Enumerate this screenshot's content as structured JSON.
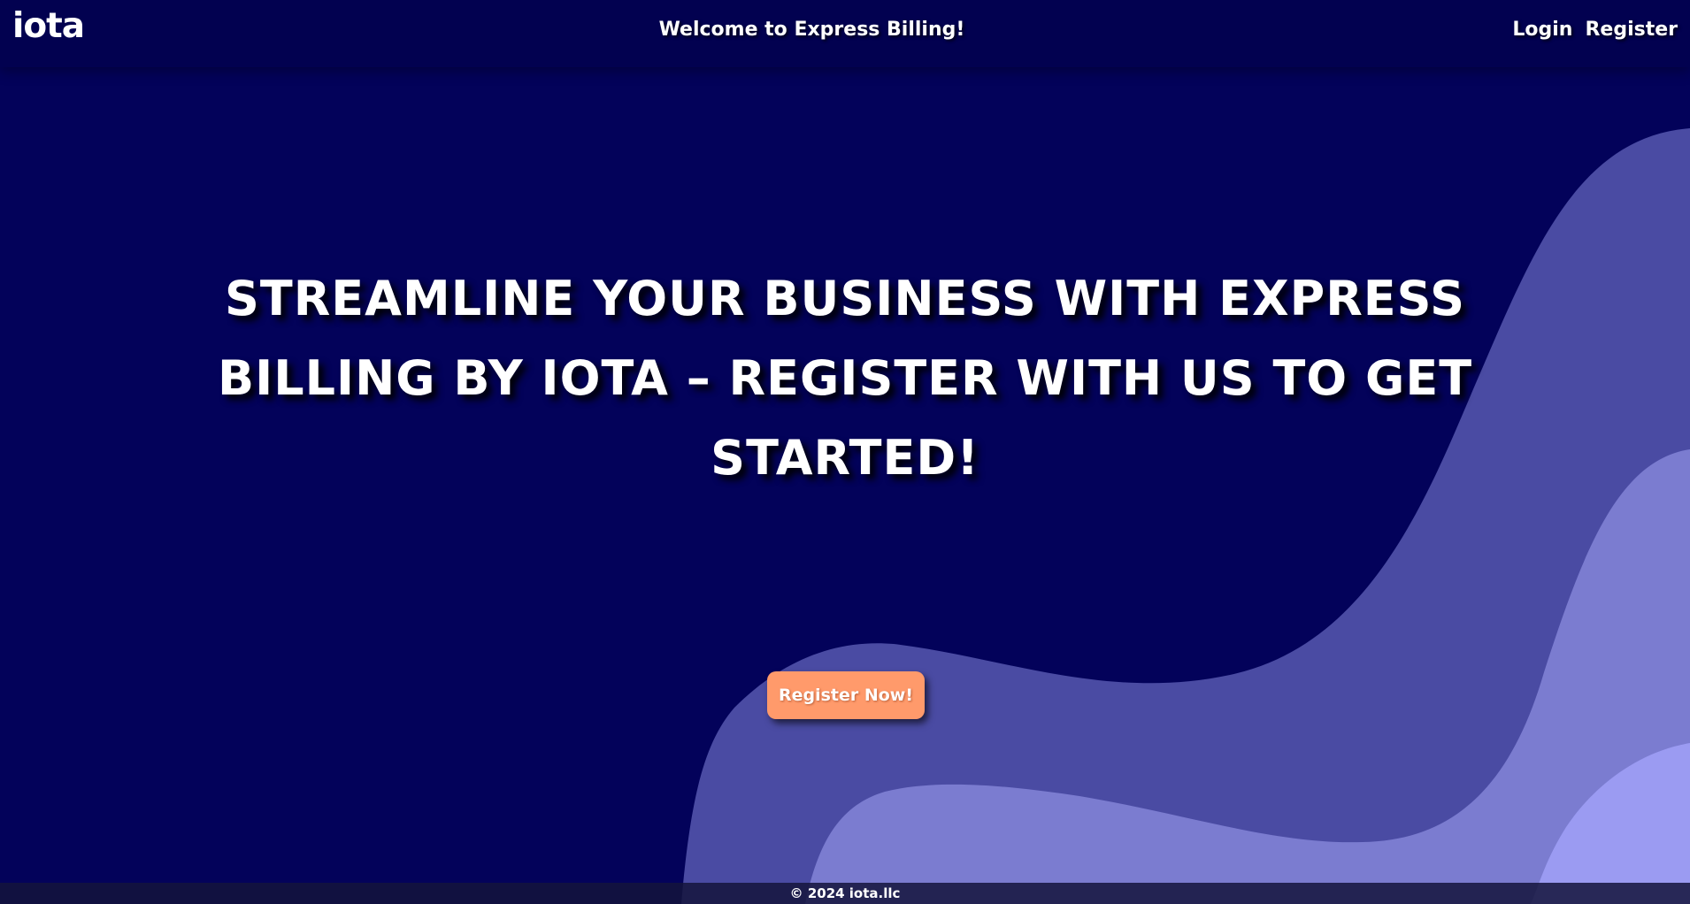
{
  "header": {
    "logo": "iota",
    "welcome": "Welcome to Express Billing!",
    "nav": {
      "login_label": "Login",
      "register_label": "Register"
    }
  },
  "hero": {
    "headline": "Streamline your business with Express Billing by iota – Register with us to get started!",
    "cta_label": "Register Now!"
  },
  "footer": {
    "copyright": "© 2024 iota.llc"
  },
  "colors": {
    "background": "#03025a",
    "wave_dark": "#4a4ba3",
    "wave_mid": "#7b7cd0",
    "wave_light": "#9b9bf2",
    "cta": "#ff9a6b",
    "text": "#ffffff"
  }
}
